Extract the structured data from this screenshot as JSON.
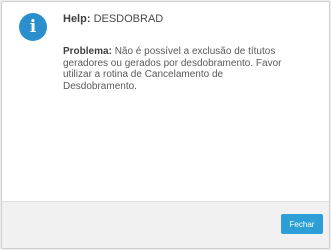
{
  "dialog": {
    "icon": "info-icon",
    "icon_glyph": "i",
    "title_label": "Help:",
    "title_value": "DESDOBRAD",
    "message_label": "Problema:",
    "message_text": "Não é possível a exclusão de títutos geradores ou gerados por desdobramento. Favor utilizar a rotina de Cancelamento de Desdobramento.",
    "close_label": "Fechar"
  },
  "colors": {
    "accent": "#2b8fce",
    "button": "#2e9fd6",
    "footer_bg": "#f1f1f1"
  }
}
